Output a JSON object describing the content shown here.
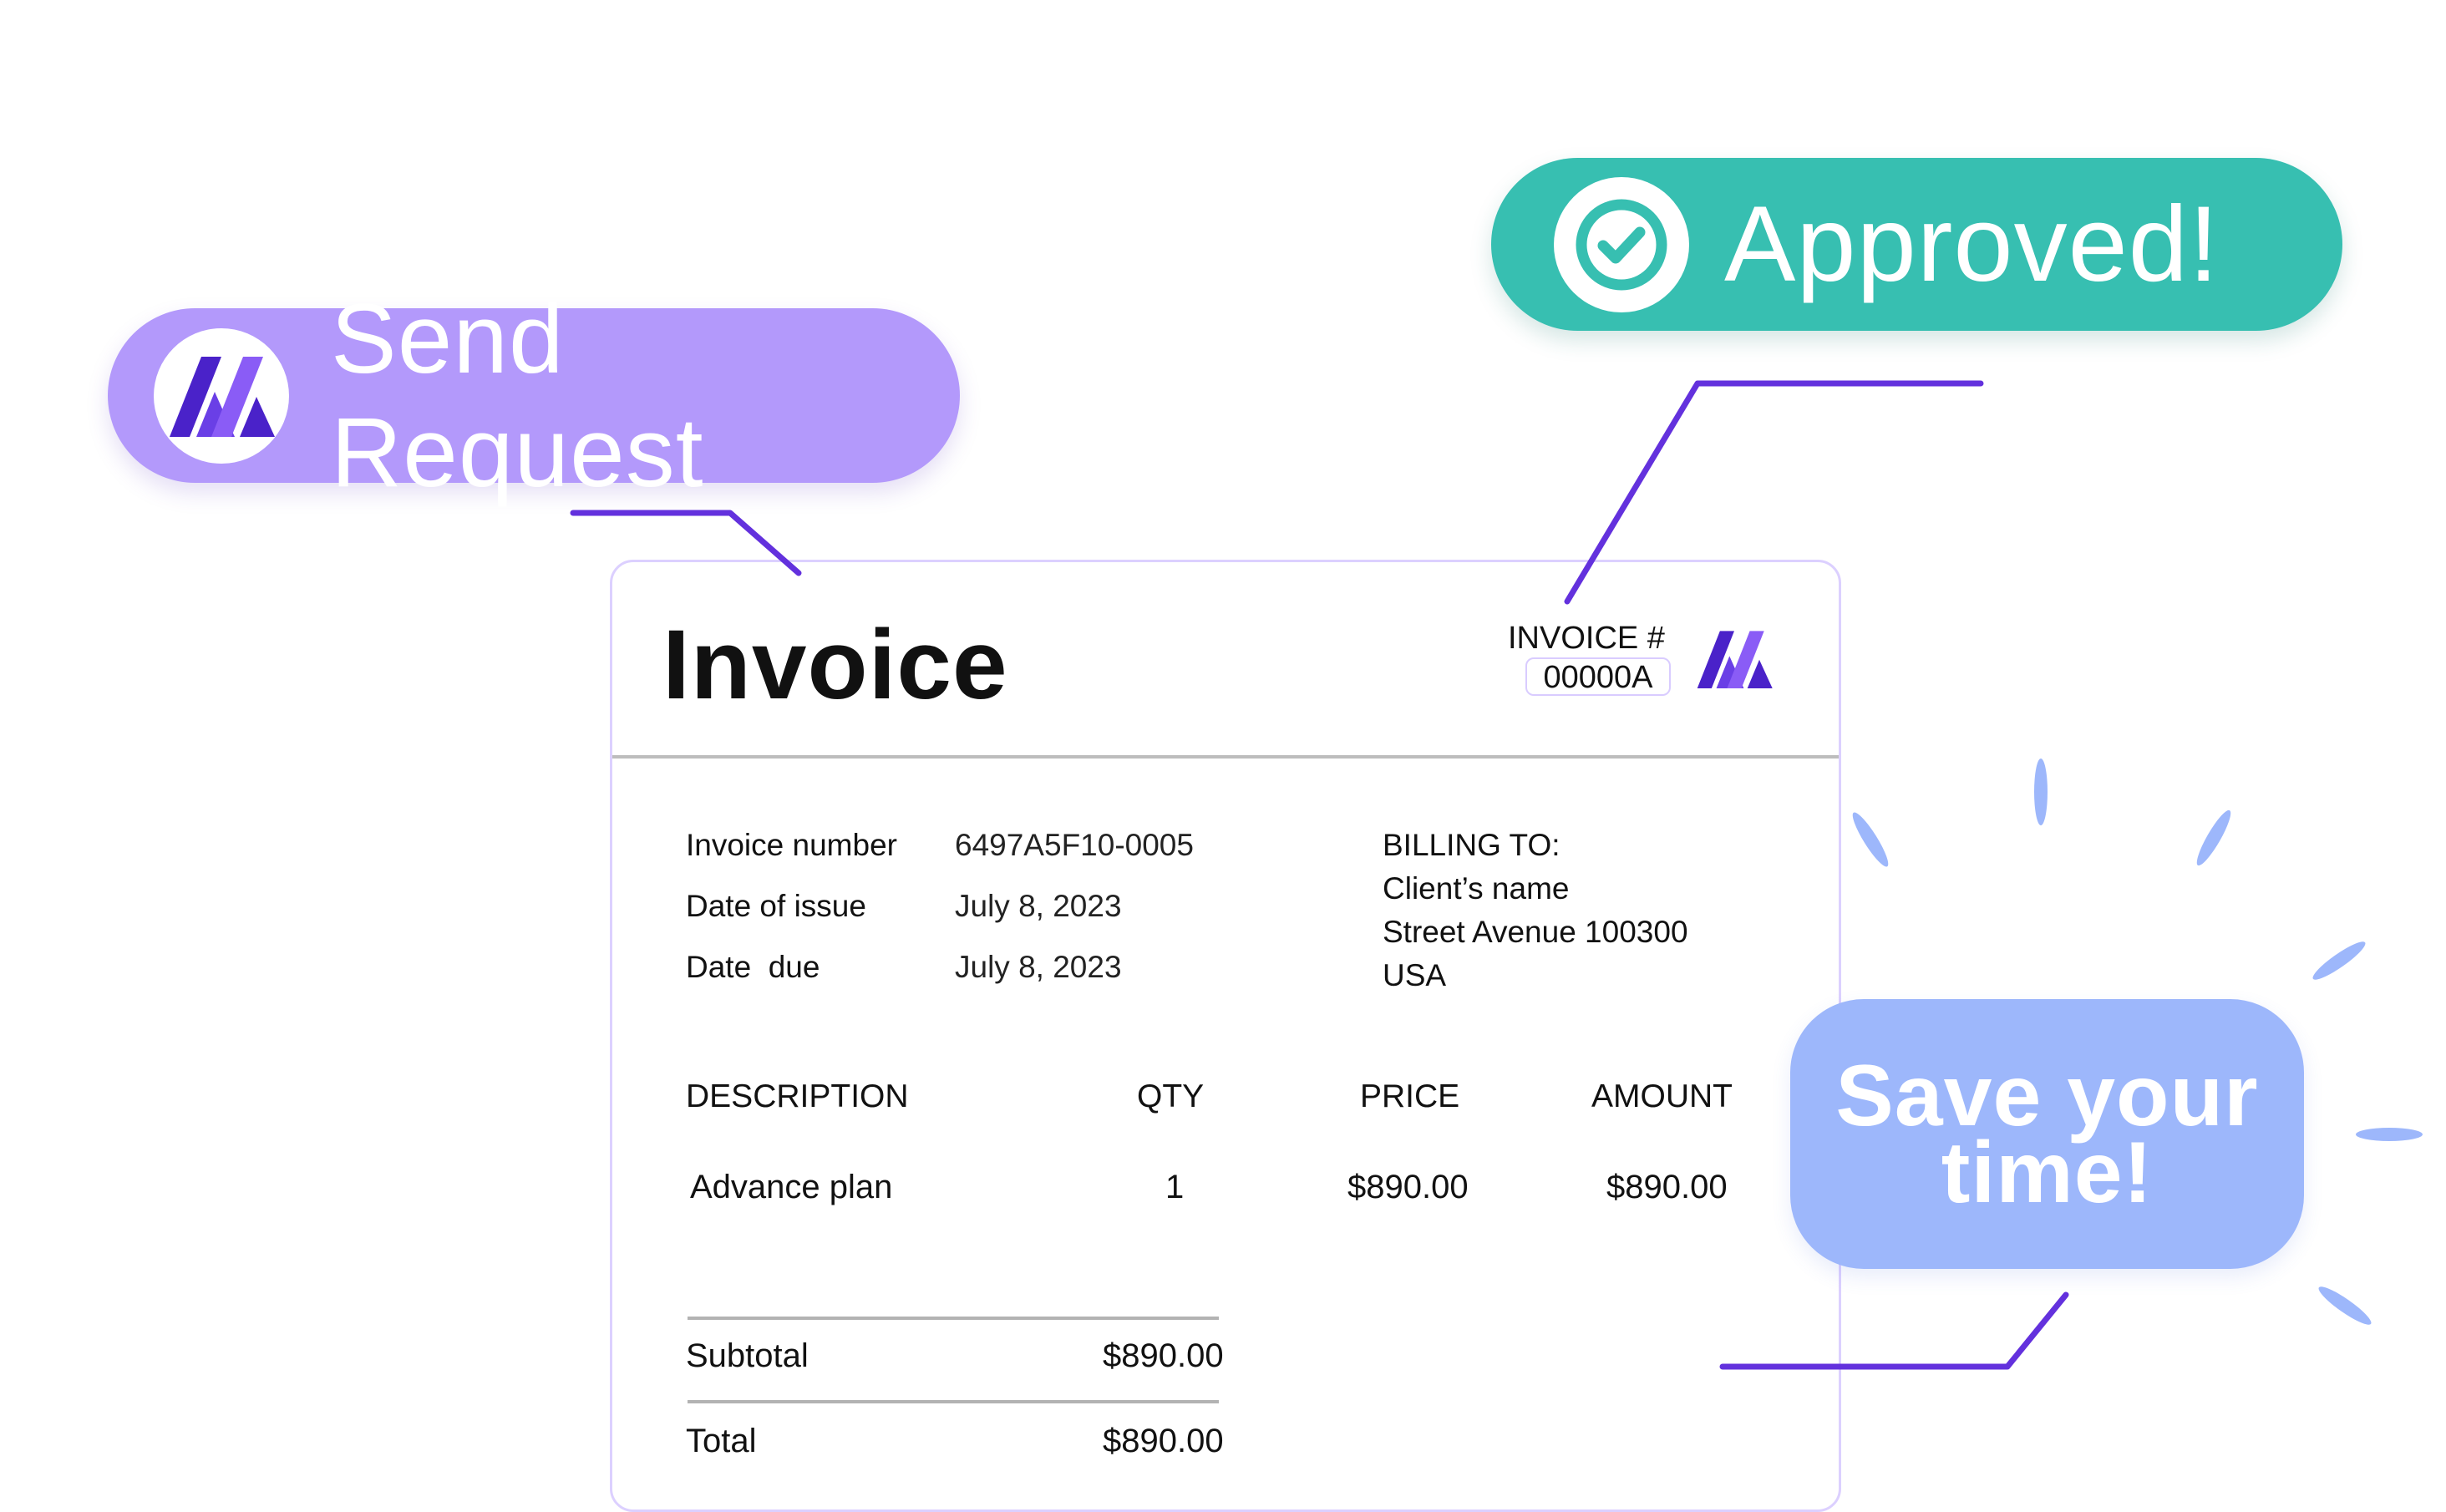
{
  "send_request": {
    "label": "Send Request",
    "icon": "logo-icon"
  },
  "approved": {
    "label": "Approved!",
    "icon": "check-circle-icon"
  },
  "save_time": {
    "line1": "Save your",
    "line2": "time!"
  },
  "invoice": {
    "title": "Invoice",
    "number_label": "INVOICE #",
    "number_value": "00000A",
    "meta": [
      {
        "label": "Invoice number",
        "value": "6497A5F10-0005"
      },
      {
        "label": "Date of issue",
        "value": "July 8, 2023"
      },
      {
        "label": "Date  due",
        "value": "July 8, 2023"
      }
    ],
    "billing": {
      "heading": "BILLING TO:",
      "name": "Client’s name",
      "street": "Street Avenue 100300",
      "country": "USA"
    },
    "table": {
      "headers": {
        "description": "DESCRIPTION",
        "qty": "QTY",
        "price": "PRICE",
        "amount": "AMOUNT"
      },
      "rows": [
        {
          "description": "Advance plan",
          "qty": "1",
          "price": "$890.00",
          "amount": "$890.00"
        }
      ]
    },
    "summary": {
      "subtotal_label": "Subtotal",
      "subtotal_value": "$890.00",
      "total_label": "Total",
      "total_value": "$890.00"
    }
  },
  "colors": {
    "send_pill": "#b399fb",
    "approved_pill": "#37bfb1",
    "save_pill": "#9db7fb",
    "connector": "#6331dd",
    "logo_dark": "#4a22c9",
    "logo_light": "#8a5cf6"
  }
}
